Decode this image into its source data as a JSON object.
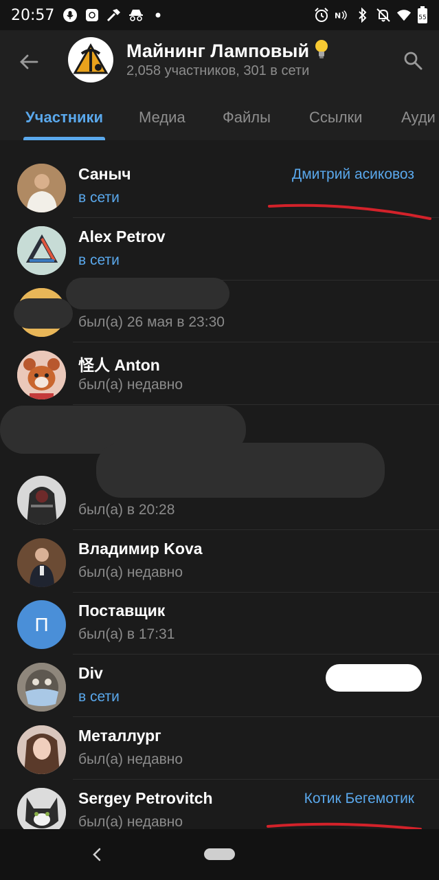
{
  "status_bar": {
    "time": "20:57",
    "battery_level": "55",
    "left_icons": [
      "microphone-icon",
      "app-notification-icon",
      "hammer-icon",
      "incognito-icon",
      "dot-icon"
    ],
    "right_icons": [
      "alarm-icon",
      "nfc-icon",
      "bluetooth-icon",
      "mute-icon",
      "wifi-icon",
      "battery-icon"
    ]
  },
  "header": {
    "title": "Майнинг Ламповый",
    "title_emoji": "💡",
    "subtitle": "2,058 участников, 301 в сети",
    "back_icon": "arrow-left-icon",
    "search_icon": "search-icon"
  },
  "tabs": [
    {
      "label": "Участники",
      "active": true
    },
    {
      "label": "Медиа",
      "active": false
    },
    {
      "label": "Файлы",
      "active": false
    },
    {
      "label": "Ссылки",
      "active": false
    },
    {
      "label": "Ауди",
      "active": false
    }
  ],
  "members": [
    {
      "name": "Саныч",
      "status": "в сети",
      "online": true,
      "role": "Дмитрий асиковоз"
    },
    {
      "name": "Alex Petrov",
      "status": "в сети",
      "online": true,
      "role": ""
    },
    {
      "name": "",
      "status": "был(а) 26 мая в 23:30",
      "online": false,
      "role": ""
    },
    {
      "name": "怪人 Anton",
      "status": "был(а) недавно",
      "online": false,
      "role": ""
    },
    {
      "name": "",
      "status": "был(а) в 20:28",
      "online": false,
      "role": ""
    },
    {
      "name": "Владимир Kova",
      "status": "был(а) недавно",
      "online": false,
      "role": ""
    },
    {
      "name": "Поставщик",
      "status": "был(а) в 17:31",
      "online": false,
      "role": "",
      "avatar_letter": "П"
    },
    {
      "name": "Div",
      "status": "в сети",
      "online": true,
      "role": ""
    },
    {
      "name": "Металлург",
      "status": "был(а) недавно",
      "online": false,
      "role": ""
    },
    {
      "name": "Sergey Petrovitch",
      "status": "был(а) недавно",
      "online": false,
      "role": "Котик Бегемотик"
    }
  ],
  "colors": {
    "accent": "#5aa8ec",
    "background": "#1b1b1b",
    "header_bg": "#202020",
    "annotation_red": "#d3222a",
    "avatar_blue": "#4a8fd8"
  },
  "navigation": {
    "back_icon": "nav-back-icon",
    "home_icon": "nav-home-pill"
  }
}
